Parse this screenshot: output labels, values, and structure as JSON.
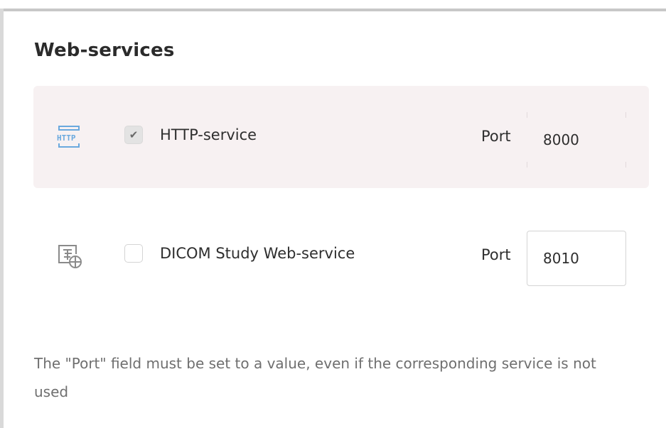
{
  "section": {
    "title": "Web-services"
  },
  "services": [
    {
      "icon": "http-icon",
      "label": "HTTP-service",
      "checked": true,
      "port_label": "Port",
      "port_value": "8000"
    },
    {
      "icon": "dicom-web-icon",
      "label": "DICOM Study Web-service",
      "checked": false,
      "port_label": "Port",
      "port_value": "8010"
    }
  ],
  "note": "The \"Port\" field must be set to a value, even if the corresponding service is not used",
  "colors": {
    "card_bg": "#f7f1f2",
    "icon_accent": "#6aa9de",
    "text": "#2e2e2e",
    "note_text": "#6f6f6f"
  }
}
